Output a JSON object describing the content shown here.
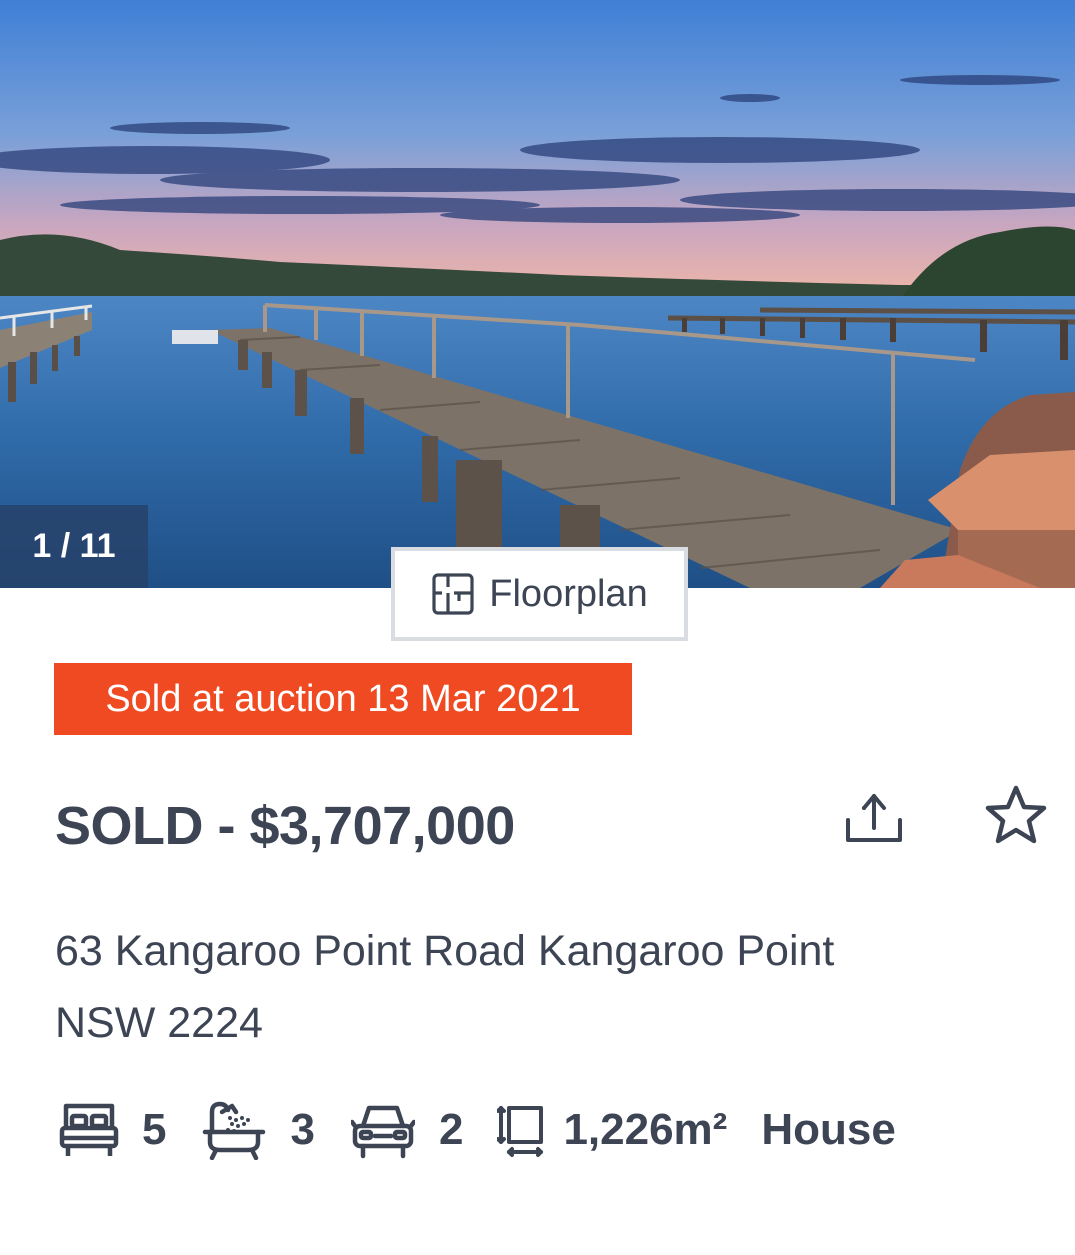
{
  "gallery": {
    "counter": "1 / 11",
    "floorplan_label": "Floorplan"
  },
  "listing": {
    "sold_badge": "Sold at auction 13 Mar 2021",
    "price": "SOLD - $3,707,000",
    "address_line1": "63 Kangaroo Point Road Kangaroo Point",
    "address_line2": "NSW 2224"
  },
  "features": {
    "bedrooms": "5",
    "bathrooms": "3",
    "car_spaces": "2",
    "land_size": "1,226m²",
    "property_type": "House"
  },
  "icons": {
    "floorplan": "floorplan-icon",
    "share": "share-icon",
    "favourite": "star-icon",
    "bed": "bed-icon",
    "bath": "bath-icon",
    "car": "car-icon",
    "land": "land-size-icon"
  },
  "colors": {
    "badge_bg": "#f04a23",
    "text": "#3d4454",
    "counter_bg": "#264066"
  }
}
